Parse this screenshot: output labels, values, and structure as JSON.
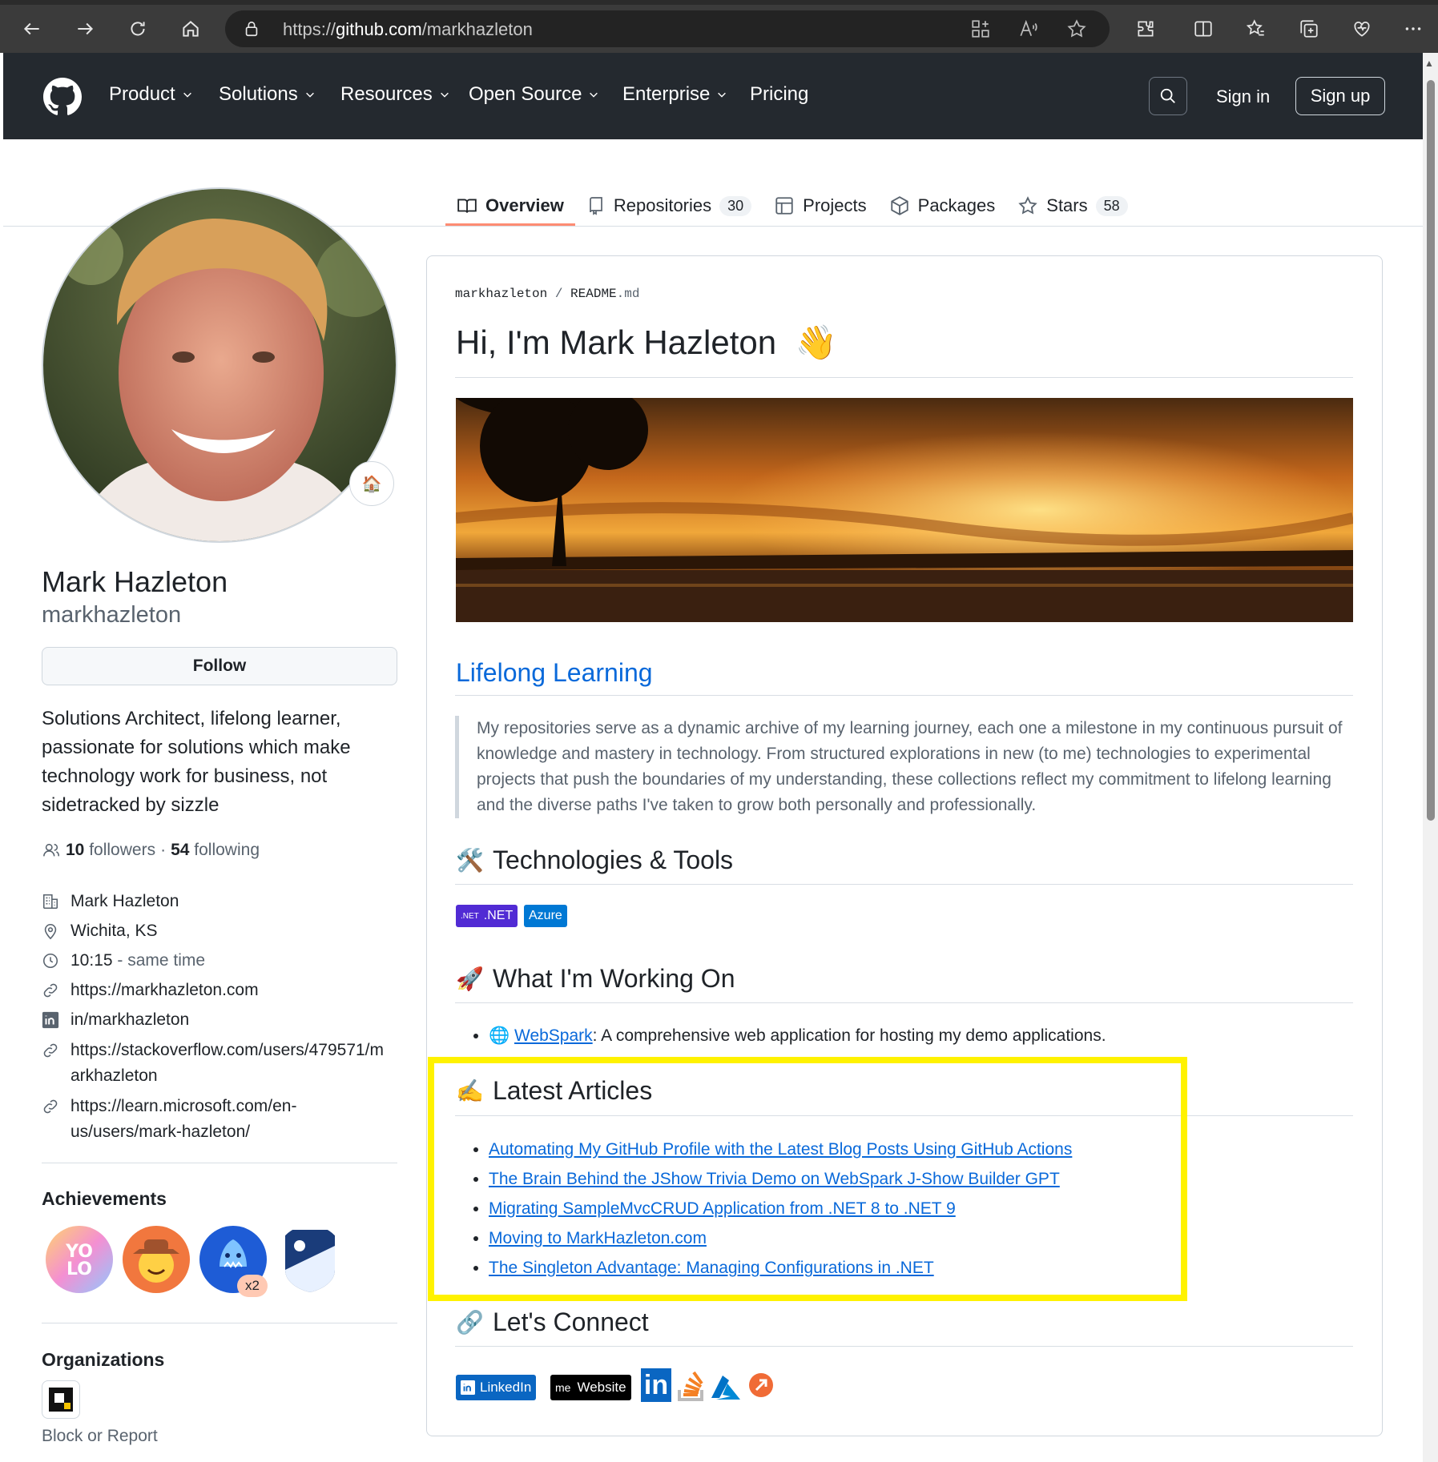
{
  "browser": {
    "url_prefix": "https://",
    "url_domain": "github.com",
    "url_path": "/markhazleton"
  },
  "nav": {
    "items": [
      "Product",
      "Solutions",
      "Resources",
      "Open Source",
      "Enterprise",
      "Pricing"
    ],
    "sign_in": "Sign in",
    "sign_up": "Sign up"
  },
  "tabs": {
    "overview": "Overview",
    "repositories": "Repositories",
    "repositories_count": "30",
    "projects": "Projects",
    "packages": "Packages",
    "stars": "Stars",
    "stars_count": "58"
  },
  "profile": {
    "name": "Mark Hazleton",
    "login": "markhazleton",
    "status_emoji": "🏠",
    "follow": "Follow",
    "bio": "Solutions Architect, lifelong learner, passionate for solutions which make technology work for business, not sidetracked by sizzle",
    "followers_count": "10",
    "followers_label": "followers",
    "following_count": "54",
    "following_label": "following",
    "dot": "·",
    "company": "Mark Hazleton",
    "location": "Wichita, KS",
    "time": "10:15",
    "time_note": "- same time",
    "website": "https://markhazleton.com",
    "linkedin": "in/markhazleton",
    "stackoverflow_1": "https://stackoverflow.com/users/479571/m",
    "stackoverflow_2": "arkhazleton",
    "learn_1": "https://learn.microsoft.com/en-",
    "learn_2": "us/users/mark-hazleton/",
    "achievements_heading": "Achievements",
    "achievement_multiplier": "x2",
    "organizations_heading": "Organizations",
    "block_report": "Block or Report"
  },
  "readme": {
    "crumb_user": "markhazleton",
    "crumb_sep": "/",
    "crumb_file_a": "README",
    "crumb_file_b": ".md",
    "title": "Hi, I'm Mark Hazleton",
    "title_emoji": "👋",
    "lifelong_heading": "Lifelong Learning",
    "lifelong_text": "My repositories serve as a dynamic archive of my learning journey, each one a milestone in my continuous pursuit of knowledge and mastery in technology. From structured explorations in new (to me) technologies to experimental projects that push the boundaries of my understanding, these collections reflect my commitment to lifelong learning and the diverse paths I've taken to grow both personally and professionally.",
    "tech_emoji": "🛠️",
    "tech_heading": "Technologies & Tools",
    "badge_net_logo": ".NET",
    "badge_net": ".NET",
    "badge_azure": "Azure",
    "working_emoji": "🚀",
    "working_heading": "What I'm Working On",
    "working_icon": "🌐",
    "working_link": "WebSpark",
    "working_text": ": A comprehensive web application for hosting my demo applications.",
    "articles_emoji": "✍️",
    "articles_heading": "Latest Articles",
    "articles": [
      "Automating My GitHub Profile with the Latest Blog Posts Using GitHub Actions",
      "The Brain Behind the JShow Trivia Demo on WebSpark J-Show Builder GPT",
      "Migrating SampleMvcCRUD Application from .NET 8 to .NET 9",
      "Moving to MarkHazleton.com",
      "The Singleton Advantage: Managing Configurations in .NET"
    ],
    "connect_emoji": "🔗",
    "connect_heading": "Let's Connect",
    "connect_linkedin": "LinkedIn",
    "connect_website_logo": "me",
    "connect_website": "Website",
    "connect_in_logo": "in"
  },
  "colors": {
    "nav_bg": "#24292f",
    "link": "#0969da",
    "highlight": "#fff200",
    "net_badge": "#512bd4",
    "azure_badge": "#0078d4"
  }
}
